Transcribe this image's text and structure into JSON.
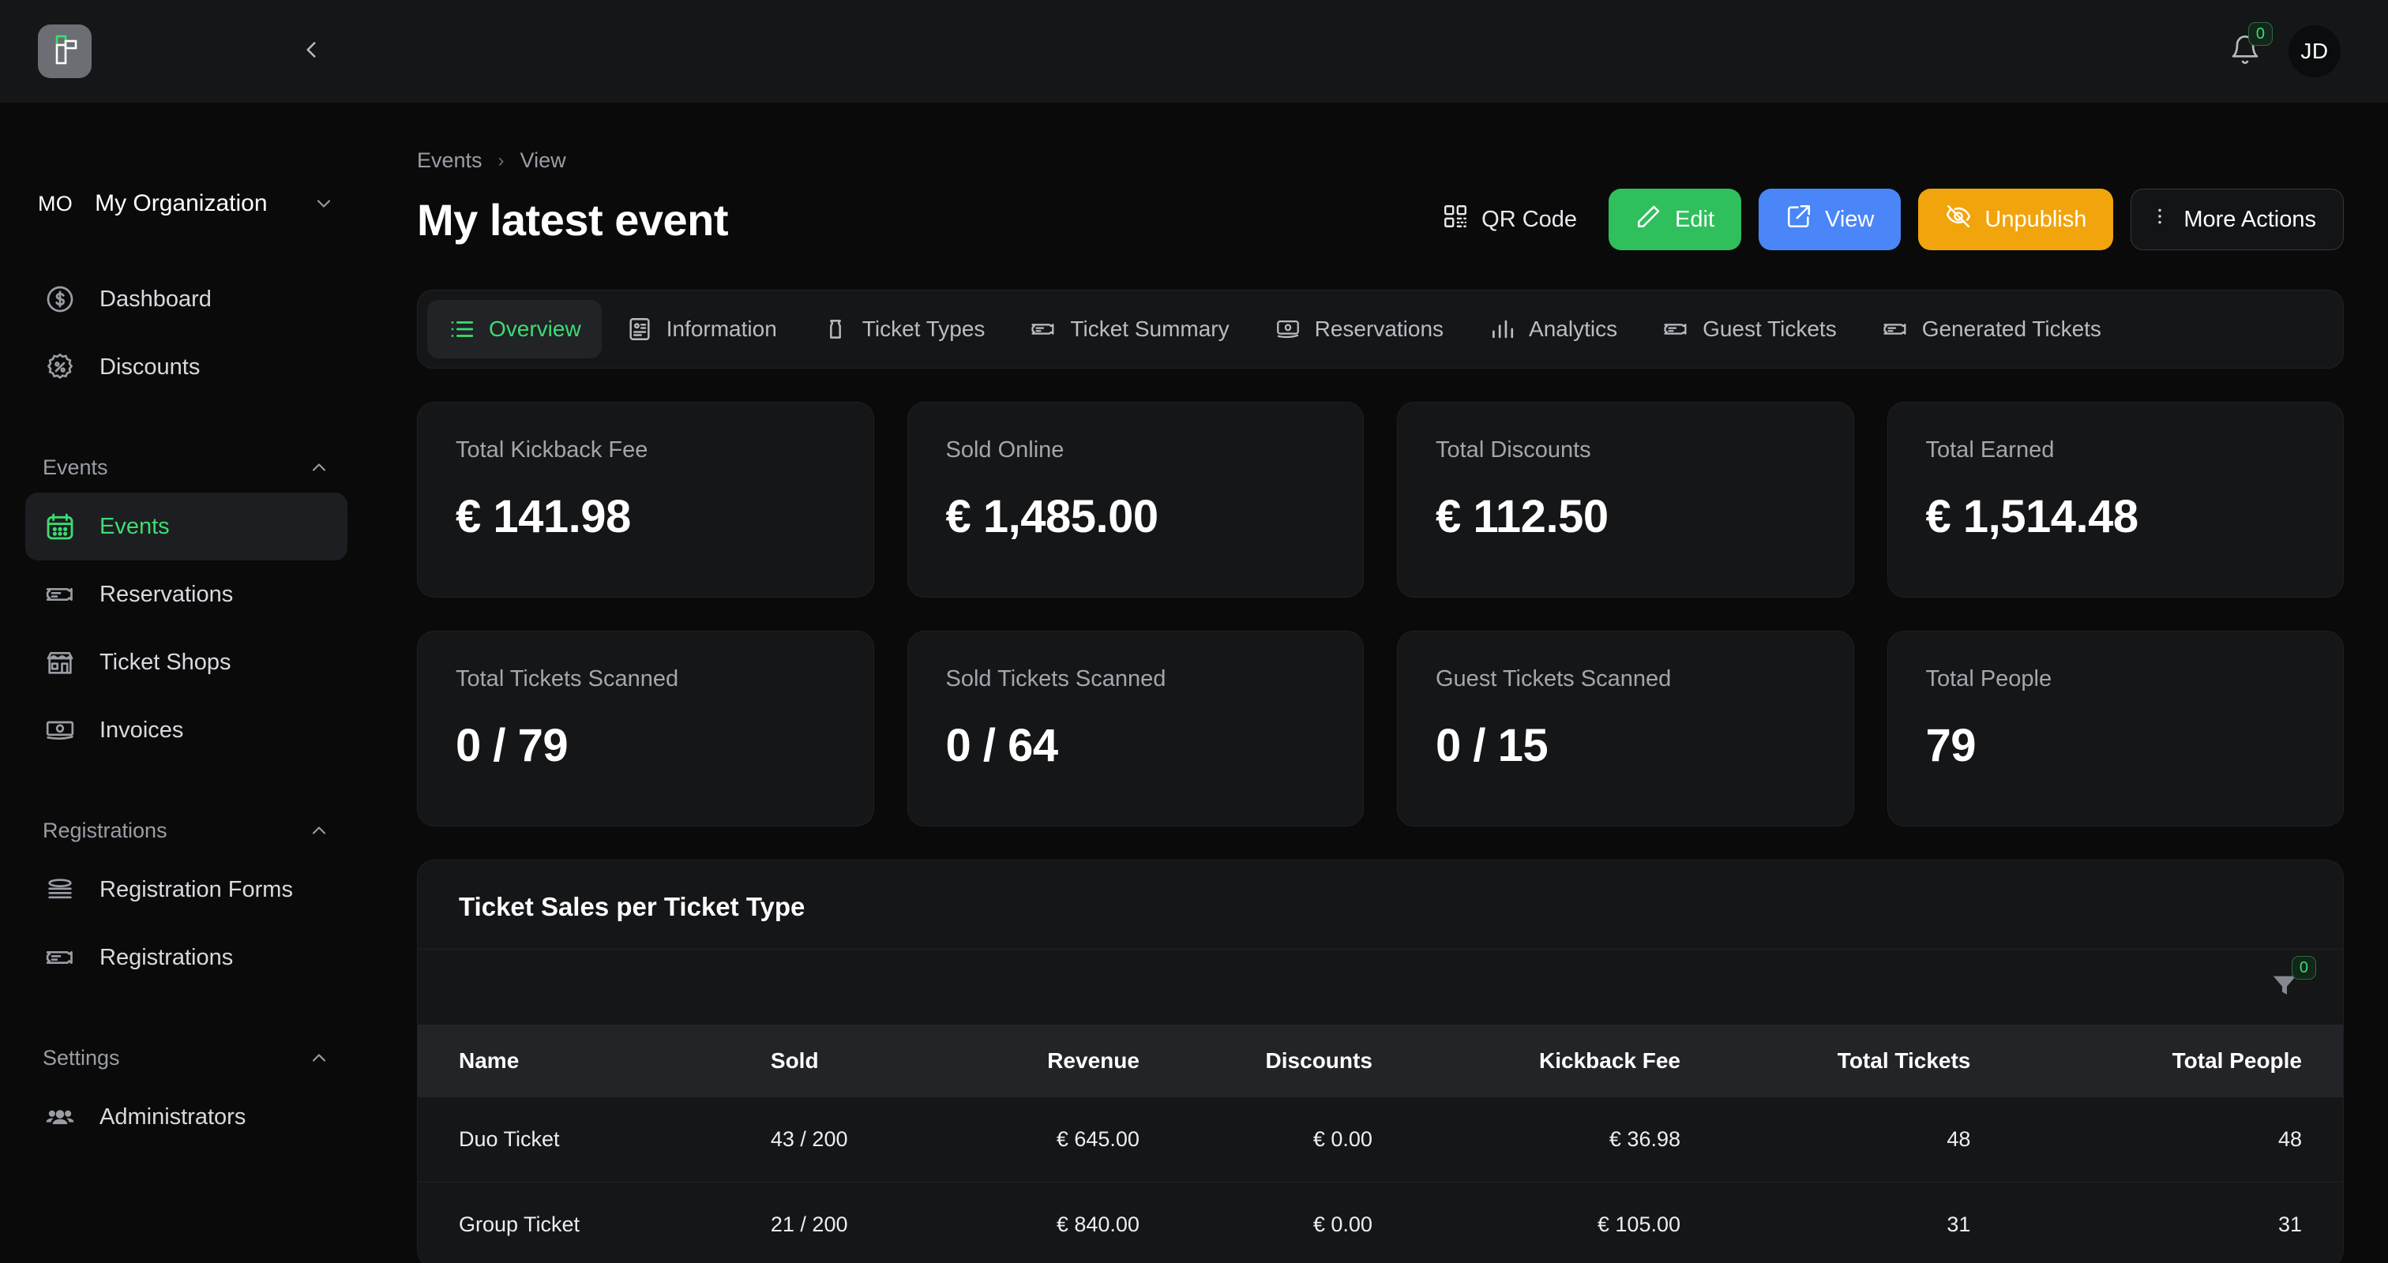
{
  "topbar": {
    "logo_icon": "app-logo-icon",
    "back_icon": "chevron-left-icon",
    "bell_icon": "bell-icon",
    "notification_count": "0",
    "avatar_initials": "JD"
  },
  "sidebar": {
    "org": {
      "abbr": "MO",
      "name": "My Organization",
      "caret_icon": "chevron-down-icon"
    },
    "top_items": [
      {
        "label": "Dashboard",
        "icon": "dollar-circle-icon",
        "active": false
      },
      {
        "label": "Discounts",
        "icon": "discount-badge-icon",
        "active": false
      }
    ],
    "sections": [
      {
        "title": "Events",
        "caret_icon": "chevron-up-icon",
        "items": [
          {
            "label": "Events",
            "icon": "calendar-icon",
            "active": true
          },
          {
            "label": "Reservations",
            "icon": "ticket-icon",
            "active": false
          },
          {
            "label": "Ticket Shops",
            "icon": "storefront-icon",
            "active": false
          },
          {
            "label": "Invoices",
            "icon": "banknote-icon",
            "active": false
          }
        ]
      },
      {
        "title": "Registrations",
        "caret_icon": "chevron-up-icon",
        "items": [
          {
            "label": "Registration Forms",
            "icon": "form-lines-icon",
            "active": false
          },
          {
            "label": "Registrations",
            "icon": "ticket-icon",
            "active": false
          }
        ]
      },
      {
        "title": "Settings",
        "caret_icon": "chevron-up-icon",
        "items": [
          {
            "label": "Administrators",
            "icon": "users-group-icon",
            "active": false
          }
        ]
      }
    ]
  },
  "main": {
    "breadcrumb": {
      "root": "Events",
      "separator": "›",
      "current": "View"
    },
    "page_title": "My latest event",
    "actions": [
      {
        "label": "QR Code",
        "icon": "qr-code-icon",
        "style": "ghost"
      },
      {
        "label": "Edit",
        "icon": "pencil-icon",
        "style": "green"
      },
      {
        "label": "View",
        "icon": "external-link-icon",
        "style": "blue"
      },
      {
        "label": "Unpublish",
        "icon": "eye-off-icon",
        "style": "amber"
      },
      {
        "label": "More Actions",
        "icon": "dots-vertical-icon",
        "style": "outline"
      }
    ],
    "tabs": [
      {
        "label": "Overview",
        "icon": "list-icon",
        "active": true
      },
      {
        "label": "Information",
        "icon": "id-card-icon",
        "active": false
      },
      {
        "label": "Ticket Types",
        "icon": "ticket-stack-icon",
        "active": false
      },
      {
        "label": "Ticket Summary",
        "icon": "ticket-icon",
        "active": false
      },
      {
        "label": "Reservations",
        "icon": "reservation-icon",
        "active": false
      },
      {
        "label": "Analytics",
        "icon": "bar-chart-icon",
        "active": false
      },
      {
        "label": "Guest Tickets",
        "icon": "ticket-icon",
        "active": false
      },
      {
        "label": "Generated Tickets",
        "icon": "ticket-icon",
        "active": false
      }
    ],
    "stat_cards": [
      {
        "label": "Total Kickback Fee",
        "value": "€ 141.98"
      },
      {
        "label": "Sold Online",
        "value": "€ 1,485.00"
      },
      {
        "label": "Total Discounts",
        "value": "€ 112.50"
      },
      {
        "label": "Total Earned",
        "value": "€ 1,514.48"
      },
      {
        "label": "Total Tickets Scanned",
        "value": "0 / 79"
      },
      {
        "label": "Sold Tickets Scanned",
        "value": "0 / 64"
      },
      {
        "label": "Guest Tickets Scanned",
        "value": "0 / 15"
      },
      {
        "label": "Total People",
        "value": "79"
      }
    ],
    "table_panel": {
      "title": "Ticket Sales per Ticket Type",
      "filter_icon": "funnel-icon",
      "filter_count": "0",
      "columns": [
        "Name",
        "Sold",
        "Revenue",
        "Discounts",
        "Kickback Fee",
        "Total Tickets",
        "Total People"
      ],
      "rows": [
        [
          "Duo Ticket",
          "43 / 200",
          "€ 645.00",
          "€ 0.00",
          "€ 36.98",
          "48",
          "48"
        ],
        [
          "Group Ticket",
          "21 / 200",
          "€ 840.00",
          "€ 0.00",
          "€ 105.00",
          "31",
          "31"
        ]
      ]
    }
  },
  "colors": {
    "accent_green": "#3ddc72",
    "button_green": "#2fbf5c",
    "button_blue": "#4a86f7",
    "button_amber": "#f2a40c",
    "panel_bg": "#151618",
    "page_bg": "#0a0a0b"
  }
}
